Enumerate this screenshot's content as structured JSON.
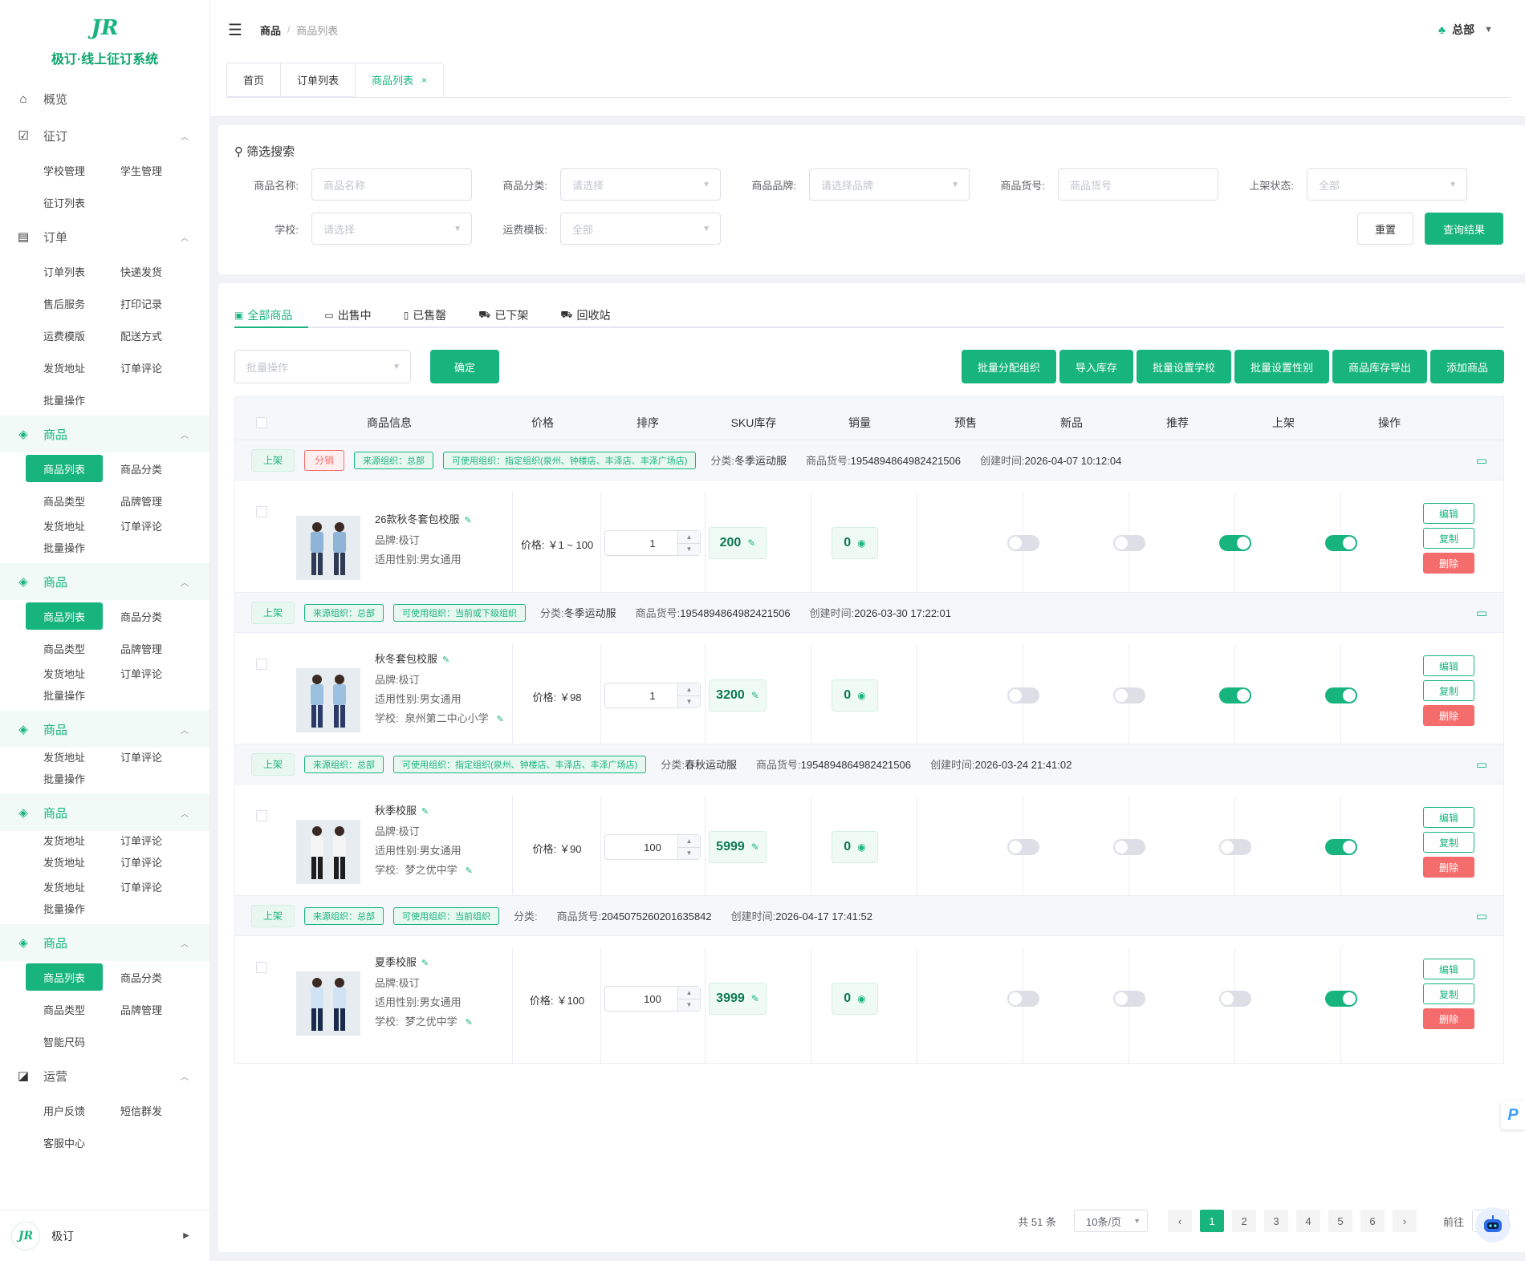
{
  "app": {
    "name": "极订·线上征订系统"
  },
  "sidebar": {
    "groups": [
      {
        "label": "概览",
        "icon": "home-icon"
      },
      {
        "label": "征订",
        "icon": "calendar-check-icon",
        "items": [
          "学校管理",
          "学生管理",
          "征订列表"
        ]
      },
      {
        "label": "订单",
        "icon": "clipboard-icon",
        "items": [
          "订单列表",
          "快递发货",
          "售后服务",
          "打印记录",
          "运费模版",
          "配送方式",
          "发货地址",
          "订单评论",
          "批量操作"
        ]
      },
      {
        "label": "商品",
        "icon": "cube-icon",
        "items": [
          "商品列表",
          "商品分类",
          "商品类型",
          "品牌管理",
          "发货地址",
          "订单评论",
          "批量操作"
        ]
      },
      {
        "label": "商品",
        "icon": "cube-icon",
        "items": [
          "商品列表",
          "商品分类",
          "商品类型",
          "品牌管理",
          "发货地址",
          "订单评论",
          "批量操作"
        ]
      },
      {
        "label": "商品",
        "icon": "cube-icon",
        "items": [
          "发货地址",
          "订单评论",
          "批量操作"
        ]
      },
      {
        "label": "商品",
        "icon": "cube-icon",
        "items": [
          "发货地址",
          "订单评论",
          "发货地址",
          "订单评论",
          "发货地址",
          "订单评论",
          "批量操作"
        ]
      },
      {
        "label": "商品",
        "icon": "cube-icon",
        "items": [
          "商品列表",
          "商品分类",
          "商品类型",
          "品牌管理",
          "智能尺码"
        ]
      },
      {
        "label": "运营",
        "icon": "chart-icon",
        "items": [
          "用户反馈",
          "短信群发",
          "客服中心"
        ]
      }
    ],
    "footer": {
      "name": "极订"
    }
  },
  "header": {
    "breadcrumb": [
      "商品",
      "商品列表"
    ],
    "user": "总部"
  },
  "tabs": [
    "首页",
    "订单列表",
    "商品列表"
  ],
  "filter": {
    "title": "筛选搜索",
    "fields": {
      "name": {
        "label": "商品名称:",
        "placeholder": "商品名称"
      },
      "category": {
        "label": "商品分类:",
        "placeholder": "请选择"
      },
      "brand": {
        "label": "商品品牌:",
        "placeholder": "请选择品牌"
      },
      "sku": {
        "label": "商品货号:",
        "placeholder": "商品货号"
      },
      "status": {
        "label": "上架状态:",
        "placeholder": "全部"
      },
      "school": {
        "label": "学校:",
        "placeholder": "请选择"
      },
      "template": {
        "label": "运费模板:",
        "placeholder": "全部"
      }
    },
    "reset": "重置",
    "query": "查询结果"
  },
  "status_tabs": [
    "全部商品",
    "出售中",
    "已售罄",
    "已下架",
    "回收站"
  ],
  "toolbar": {
    "batch_placeholder": "批量操作",
    "confirm": "确定",
    "actions": [
      "批量分配组织",
      "导入库存",
      "批量设置学校",
      "批量设置性别",
      "商品库存导出",
      "添加商品"
    ]
  },
  "table": {
    "columns": [
      "商品信息",
      "价格",
      "排序",
      "SKU库存",
      "销量",
      "预售",
      "新品",
      "推荐",
      "上架",
      "操作"
    ]
  },
  "labels": {
    "price": "价格:",
    "brand": "品牌:",
    "gender": "适用性别:",
    "school": "学校:",
    "category": "分类:",
    "code": "商品货号:",
    "created": "创建时间:",
    "edit": "编辑",
    "copy": "复制",
    "delete": "删除"
  },
  "products": [
    {
      "status": "上架",
      "extra_tag": "分销",
      "src_org": "来源组织：总部",
      "use_org": "可使用组织：指定组织(泉州、钟楼店、丰泽店、丰泽广场店)",
      "category": "冬季运动服",
      "code": "1954894864982421506",
      "created": "2026-04-07 10:12:04",
      "name": "26款秋冬套包校服",
      "brand": "极订",
      "gender": "男女通用",
      "school": "",
      "price": "￥1 ~ 100",
      "sort": "1",
      "stock": "200",
      "sales": "0",
      "presale": false,
      "newp": false,
      "recommend": true,
      "onshelf": true
    },
    {
      "status": "上架",
      "extra_tag": "",
      "src_org": "来源组织：总部",
      "use_org": "可使用组织：当前或下级组织",
      "category": "冬季运动服",
      "code": "1954894864982421506",
      "created": "2026-03-30 17:22:01",
      "name": "秋冬套包校服",
      "brand": "极订",
      "gender": "男女通用",
      "school": "泉州第二中心小学",
      "price": "￥98",
      "sort": "1",
      "stock": "3200",
      "sales": "0",
      "presale": false,
      "newp": false,
      "recommend": true,
      "onshelf": true
    },
    {
      "status": "上架",
      "extra_tag": "",
      "src_org": "来源组织：总部",
      "use_org": "可使用组织：指定组织(泉州、钟楼店、丰泽店、丰泽广场店)",
      "category": "春秋运动服",
      "code": "1954894864982421506",
      "created": "2026-03-24 21:41:02",
      "name": "秋季校服",
      "brand": "极订",
      "gender": "男女通用",
      "school": "梦之优中学",
      "price": "￥90",
      "sort": "100",
      "stock": "5999",
      "sales": "0",
      "presale": false,
      "newp": false,
      "recommend": false,
      "onshelf": true
    },
    {
      "status": "上架",
      "extra_tag": "",
      "src_org": "来源组织：总部",
      "use_org": "可使用组织：当前组织",
      "category": "",
      "code": "2045075260201635842",
      "created": "2026-04-17 17:41:52",
      "name": "夏季校服",
      "brand": "极订",
      "gender": "男女通用",
      "school": "梦之优中学",
      "price": "￥100",
      "sort": "100",
      "stock": "3999",
      "sales": "0",
      "presale": false,
      "newp": false,
      "recommend": false,
      "onshelf": true
    }
  ],
  "pagination": {
    "total": "共 51 条",
    "page_size": "10条/页",
    "pages": [
      "1",
      "2",
      "3",
      "4",
      "5",
      "6"
    ],
    "current": "1",
    "goto_label": "前往",
    "goto_value": "1"
  },
  "colors": {
    "brand": "#18b47e",
    "danger": "#f56c6c"
  }
}
